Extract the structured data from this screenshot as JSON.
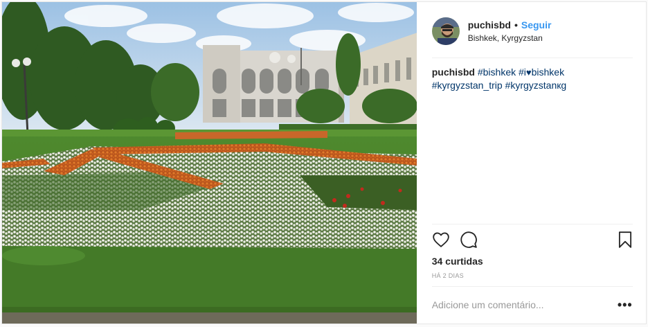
{
  "post": {
    "username": "puchisbd",
    "separator": "•",
    "follow_label": "Seguir",
    "location": "Bishkek, Kyrgyzstan",
    "caption": {
      "user": "puchisbd",
      "tags": [
        "#bishkek",
        "#i",
        "bishkek",
        "#kyrgyzstan_trip",
        "#kyrgyzstanкg"
      ],
      "heart": "♥"
    },
    "likes": "34 curtidas",
    "time": "HÁ 2 DIAS",
    "comment_placeholder": "Adicione um comentário...",
    "more_label": "•••"
  },
  "icons": {
    "like": "heart-outline-icon",
    "comment": "speech-bubble-icon",
    "save": "bookmark-icon"
  },
  "colors": {
    "link": "#3897f0",
    "hashtag": "#003569",
    "muted": "#999999",
    "text": "#262626"
  }
}
